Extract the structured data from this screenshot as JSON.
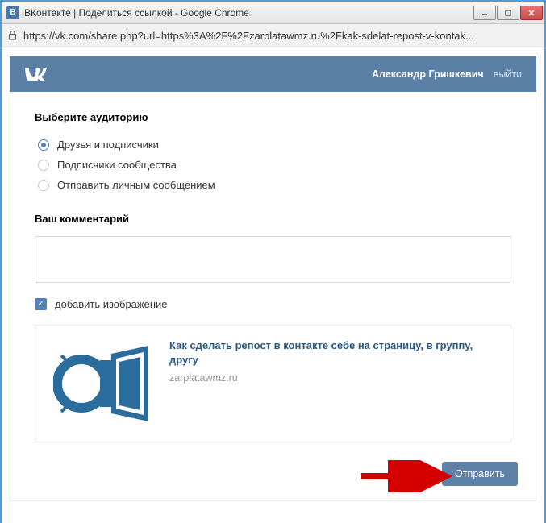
{
  "window": {
    "title": "ВКонтакте | Поделиться ссылкой - Google Chrome",
    "favicon_text": "В"
  },
  "address": "https://vk.com/share.php?url=https%3A%2F%2Fzarplatawmz.ru%2Fkak-sdelat-repost-v-kontak...",
  "header": {
    "username": "Александр Гришкевич",
    "logout": "выйти"
  },
  "share": {
    "audience_title": "Выберите аудиторию",
    "options": [
      {
        "label": "Друзья и подписчики",
        "selected": true
      },
      {
        "label": "Подписчики сообщества",
        "selected": false
      },
      {
        "label": "Отправить личным сообщением",
        "selected": false
      }
    ],
    "comment_title": "Ваш комментарий",
    "comment_value": "",
    "add_image_label": "добавить изображение",
    "add_image_checked": true,
    "preview": {
      "title": "Как сделать репост в контакте себе на страницу, в группу, другу",
      "domain": "zarplatawmz.ru"
    },
    "submit": "Отправить"
  }
}
